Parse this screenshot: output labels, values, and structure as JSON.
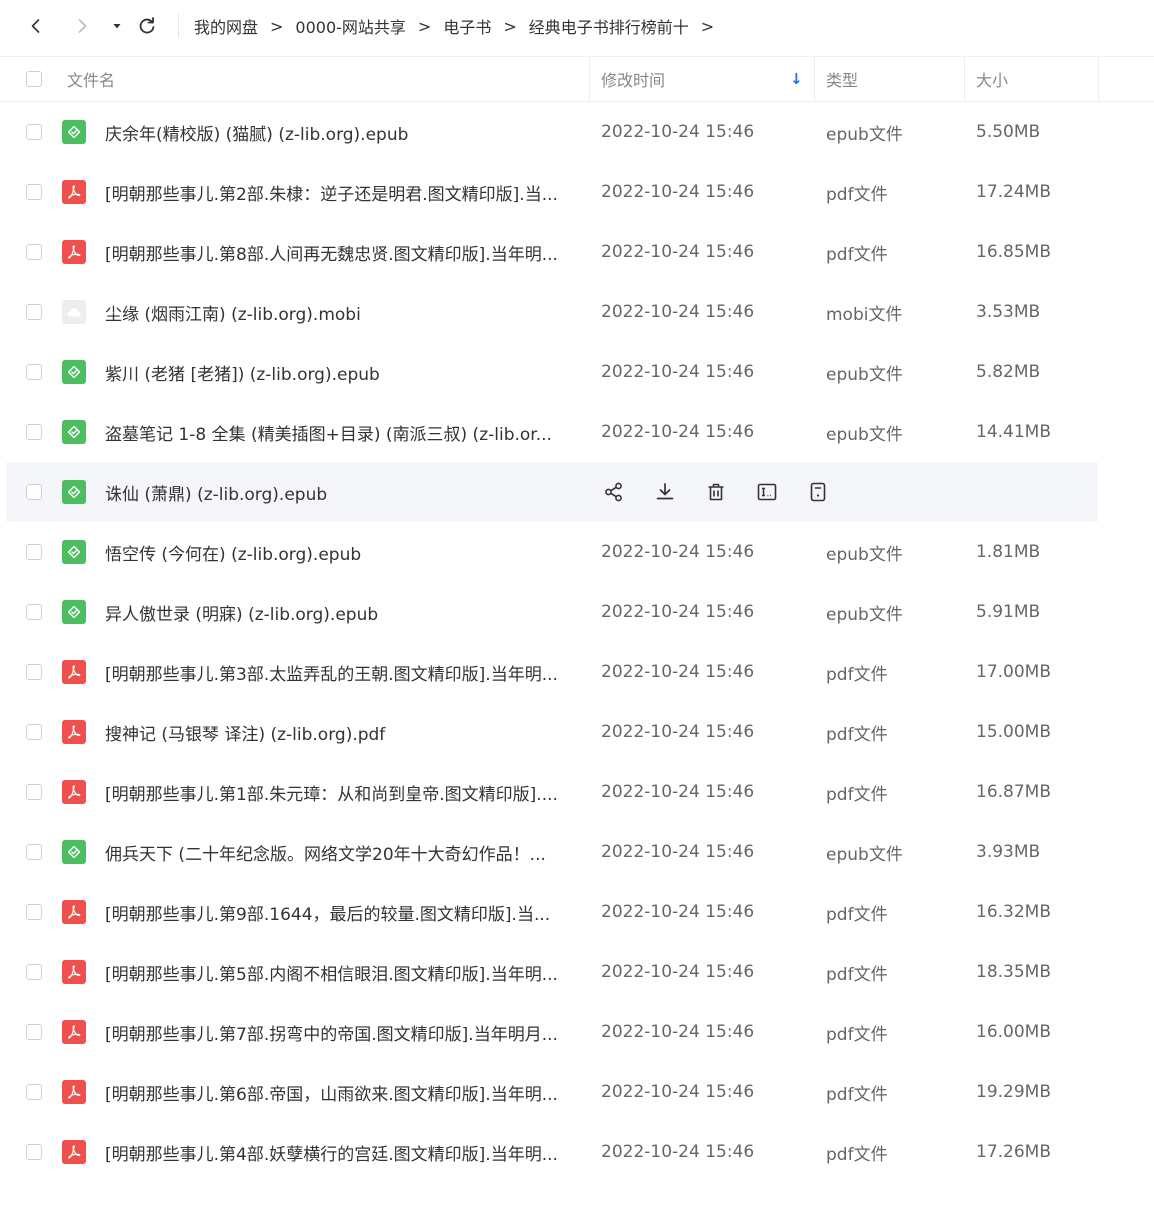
{
  "nav": {
    "breadcrumbs": [
      "我的网盘",
      "0000-网站共享",
      "电子书",
      "经典电子书排行榜前十"
    ],
    "separator": ">"
  },
  "header": {
    "name": "文件名",
    "modified": "修改时间",
    "sort_indicator": "↓",
    "type": "类型",
    "size": "大小"
  },
  "files": [
    {
      "name": "庆余年(精校版) (猫腻) (z-lib.org).epub",
      "modified": "2022-10-24 15:46",
      "type": "epub文件",
      "size": "5.50MB",
      "icon": "epub-file-icon"
    },
    {
      "name": "[明朝那些事儿.第2部.朱棣：逆子还是明君.图文精印版].当...",
      "modified": "2022-10-24 15:46",
      "type": "pdf文件",
      "size": "17.24MB",
      "icon": "pdf-file-icon"
    },
    {
      "name": "[明朝那些事儿.第8部.人间再无魏忠贤.图文精印版].当年明...",
      "modified": "2022-10-24 15:46",
      "type": "pdf文件",
      "size": "16.85MB",
      "icon": "pdf-file-icon"
    },
    {
      "name": "尘缘 (烟雨江南) (z-lib.org).mobi",
      "modified": "2022-10-24 15:46",
      "type": "mobi文件",
      "size": "3.53MB",
      "icon": "mobi-file-icon"
    },
    {
      "name": "紫川 (老猪 [老猪]) (z-lib.org).epub",
      "modified": "2022-10-24 15:46",
      "type": "epub文件",
      "size": "5.82MB",
      "icon": "epub-file-icon"
    },
    {
      "name": "盗墓笔记 1-8 全集 (精美插图+目录) (南派三叔) (z-lib.or...",
      "modified": "2022-10-24 15:46",
      "type": "epub文件",
      "size": "14.41MB",
      "icon": "epub-file-icon"
    },
    {
      "name": "诛仙 (萧鼎) (z-lib.org).epub",
      "modified": "",
      "type": "",
      "size": "",
      "icon": "epub-file-icon",
      "hovered": true
    },
    {
      "name": "悟空传 (今何在) (z-lib.org).epub",
      "modified": "2022-10-24 15:46",
      "type": "epub文件",
      "size": "1.81MB",
      "icon": "epub-file-icon"
    },
    {
      "name": "异人傲世录 (明寐) (z-lib.org).epub",
      "modified": "2022-10-24 15:46",
      "type": "epub文件",
      "size": "5.91MB",
      "icon": "epub-file-icon"
    },
    {
      "name": "[明朝那些事儿.第3部.太监弄乱的王朝.图文精印版].当年明...",
      "modified": "2022-10-24 15:46",
      "type": "pdf文件",
      "size": "17.00MB",
      "icon": "pdf-file-icon"
    },
    {
      "name": "搜神记 (马银琴 译注) (z-lib.org).pdf",
      "modified": "2022-10-24 15:46",
      "type": "pdf文件",
      "size": "15.00MB",
      "icon": "pdf-file-icon"
    },
    {
      "name": "[明朝那些事儿.第1部.朱元璋：从和尚到皇帝.图文精印版]....",
      "modified": "2022-10-24 15:46",
      "type": "pdf文件",
      "size": "16.87MB",
      "icon": "pdf-file-icon"
    },
    {
      "name": "佣兵天下 (二十年纪念版。网络文学20年十大奇幻作品！...",
      "modified": "2022-10-24 15:46",
      "type": "epub文件",
      "size": "3.93MB",
      "icon": "epub-file-icon"
    },
    {
      "name": "[明朝那些事儿.第9部.1644，最后的较量.图文精印版].当...",
      "modified": "2022-10-24 15:46",
      "type": "pdf文件",
      "size": "16.32MB",
      "icon": "pdf-file-icon"
    },
    {
      "name": "[明朝那些事儿.第5部.内阁不相信眼泪.图文精印版].当年明...",
      "modified": "2022-10-24 15:46",
      "type": "pdf文件",
      "size": "18.35MB",
      "icon": "pdf-file-icon"
    },
    {
      "name": "[明朝那些事儿.第7部.拐弯中的帝国.图文精印版].当年明月...",
      "modified": "2022-10-24 15:46",
      "type": "pdf文件",
      "size": "16.00MB",
      "icon": "pdf-file-icon"
    },
    {
      "name": "[明朝那些事儿.第6部.帝国，山雨欲来.图文精印版].当年明...",
      "modified": "2022-10-24 15:46",
      "type": "pdf文件",
      "size": "19.29MB",
      "icon": "pdf-file-icon"
    },
    {
      "name": "[明朝那些事儿.第4部.妖孽横行的宫廷.图文精印版].当年明...",
      "modified": "2022-10-24 15:46",
      "type": "pdf文件",
      "size": "17.26MB",
      "icon": "pdf-file-icon"
    }
  ],
  "row_actions": [
    "share-icon",
    "download-icon",
    "delete-icon",
    "rename-icon",
    "more-info-icon"
  ],
  "colors": {
    "epub": "#4cbd60",
    "pdf": "#f0504d",
    "mobi": "#eeeeee",
    "sort_arrow": "#1a73e8",
    "hover_row": "#f5f6f9"
  }
}
